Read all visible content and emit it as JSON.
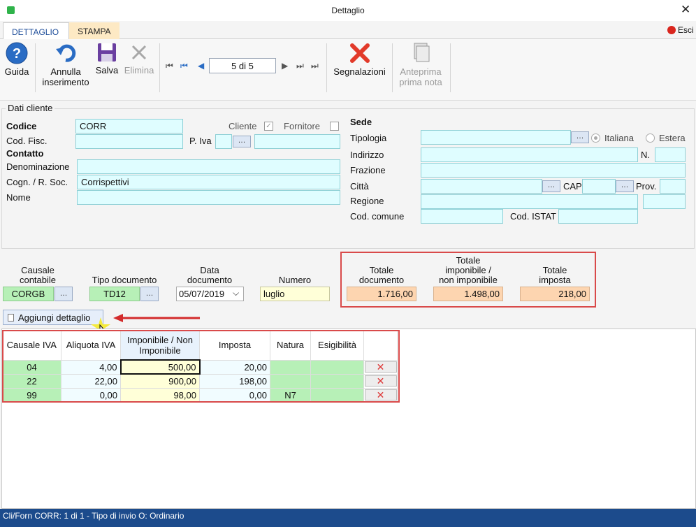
{
  "window": {
    "title": "Dettaglio"
  },
  "tabs": [
    {
      "label": "DETTAGLIO"
    },
    {
      "label": "STAMPA"
    }
  ],
  "esci_label": "Esci",
  "toolbar": {
    "guida": "Guida",
    "annulla": "Annulla",
    "annulla2": "inserimento",
    "salva": "Salva",
    "elimina": "Elimina",
    "record_nav": "5 di 5",
    "segnalazioni": "Segnalazioni",
    "anteprima": "Anteprima",
    "anteprima2": "prima nota"
  },
  "dati_cliente": {
    "legend": "Dati cliente",
    "codice_label": "Codice",
    "codice_value": "CORR",
    "cliente_label": "Cliente",
    "fornitore_label": "Fornitore",
    "cod_fisc_label": "Cod. Fisc.",
    "piva_label": "P. Iva",
    "contatto_label": "Contatto",
    "denominazione_label": "Denominazione",
    "cognome_label": "Cogn. / R. Soc.",
    "cognome_value": "Corrispettivi",
    "nome_label": "Nome"
  },
  "sede": {
    "title": "Sede",
    "tipologia_label": "Tipologia",
    "italiana_label": "Italiana",
    "estera_label": "Estera",
    "indirizzo_label": "Indirizzo",
    "n_label": "N.",
    "frazione_label": "Frazione",
    "citta_label": "Città",
    "cap_label": "CAP",
    "prov_label": "Prov.",
    "regione_label": "Regione",
    "cod_comune_label": "Cod. comune",
    "cod_istat_label": "Cod. ISTAT"
  },
  "documento": {
    "causale_label_1": "Causale",
    "causale_label_2": "contabile",
    "causale_value": "CORGB",
    "tipo_label": "Tipo documento",
    "tipo_value": "TD12",
    "data_label_1": "Data",
    "data_label_2": "documento",
    "data_value": "05/07/2019",
    "numero_label": "Numero",
    "numero_value": "luglio",
    "tot_doc_label_1": "Totale",
    "tot_doc_label_2": "documento",
    "tot_doc_value": "1.716,00",
    "tot_imp_label_1": "Totale",
    "tot_imp_label_2": "imponibile /",
    "tot_imp_label_3": "non imponibile",
    "tot_imp_value": "1.498,00",
    "tot_iva_label_1": "Totale",
    "tot_iva_label_2": "imposta",
    "tot_iva_value": "218,00"
  },
  "aggiungi_label": "Aggiungi dettaglio",
  "grid": {
    "headers": {
      "causale": "Causale IVA",
      "aliquota": "Aliquota IVA",
      "imponibile_1": "Imponibile / Non",
      "imponibile_2": "Imponibile",
      "imposta": "Imposta",
      "natura": "Natura",
      "esigibilita": "Esigibilità"
    },
    "rows": [
      {
        "causale": "04",
        "aliquota": "4,00",
        "imponibile": "500,00",
        "imposta": "20,00",
        "natura": "",
        "esigibilita": ""
      },
      {
        "causale": "22",
        "aliquota": "22,00",
        "imponibile": "900,00",
        "imposta": "198,00",
        "natura": "",
        "esigibilita": ""
      },
      {
        "causale": "99",
        "aliquota": "0,00",
        "imponibile": "98,00",
        "imposta": "0,00",
        "natura": "N7",
        "esigibilita": ""
      }
    ]
  },
  "status": {
    "line1": "Cli/Forn CORR: 1 di 1 - Tipo di invio O: Ordinario"
  },
  "colors": {
    "accent": "#1c4b8c",
    "highlight_red": "#d94a4a",
    "field_cyan": "#dffdff"
  }
}
